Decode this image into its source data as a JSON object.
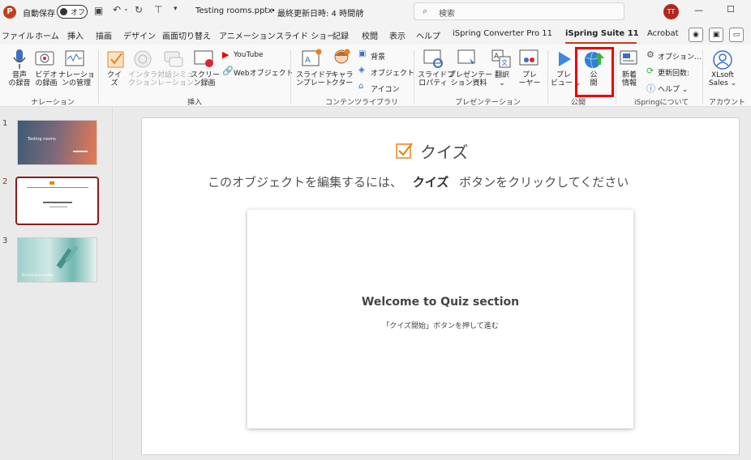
{
  "titlebar": {
    "app_icon": "P",
    "autosave_label": "自動保存",
    "autosave_state": "オフ",
    "filename": "Testing rooms.pptx",
    "separator": "•",
    "last_saved": "最終更新日時: 4 時間前",
    "search_placeholder": "検索",
    "user_initials": "TT"
  },
  "menu": {
    "tabs": [
      "ファイル",
      "ホーム",
      "挿入",
      "描画",
      "デザイン",
      "画面切り替え",
      "アニメーション",
      "スライド ショー",
      "記録",
      "校閲",
      "表示",
      "ヘルプ",
      "iSpring Converter Pro 11",
      "iSpring Suite 11",
      "Acrobat"
    ],
    "active_tab": "iSpring Suite 11"
  },
  "ribbon": {
    "narration": {
      "group": "ナレーション",
      "record_audio": [
        "音声",
        "の録音"
      ],
      "record_video": [
        "ビデオ",
        "の録画"
      ],
      "manage_narration": [
        "ナレーショ",
        "ンの管理"
      ]
    },
    "insert": {
      "group": "挿入",
      "quiz": [
        "クイ",
        "ズ"
      ],
      "interaction": [
        "インタラ",
        "クション"
      ],
      "dialog": [
        "対話シミュ",
        "レーション"
      ],
      "screen_record": [
        "スクリー",
        "ン録画"
      ],
      "youtube": "YouTube",
      "web_object": "Webオブジェクト"
    },
    "content_library": {
      "group": "コンテンツライブラリ",
      "slide_template": [
        "スライドテ",
        "ンプレート"
      ],
      "character": [
        "キャラ",
        "クター"
      ],
      "background": "背景",
      "objects": "オブジェクト",
      "icons": "アイコン"
    },
    "presentation": {
      "group": "プレゼンテーション",
      "slide_properties": [
        "スライドプ",
        "ロパティ"
      ],
      "presentation_resources": [
        "プレゼンテー",
        "ション資料"
      ],
      "translate": [
        "翻訳",
        "⌄"
      ],
      "player": [
        "プレ",
        "ーヤー"
      ]
    },
    "publish": {
      "group": "公開",
      "preview": [
        "プレ",
        "ビュー ⌄"
      ],
      "publish": [
        "公",
        "開"
      ]
    },
    "about": {
      "group": "iSpringについて",
      "whats_new": [
        "新着",
        "情報"
      ],
      "options": "オプション…",
      "update_count": "更新回数:",
      "help": "ヘルプ ⌄"
    },
    "account": {
      "group": "アカウント",
      "user": [
        "XLsoft",
        "Sales ⌄"
      ]
    }
  },
  "slides": {
    "numbers": [
      "1",
      "2",
      "3"
    ],
    "thumb1_title": "Testing rooms",
    "thumb3_text": "Ending Quiz section"
  },
  "slide": {
    "quiz_title": "クイズ",
    "instruction_before": "このオブジェクトを編集するには、",
    "instruction_bold": "クイズ",
    "instruction_after": "ボタンをクリックしてください",
    "card_title": "Welcome to Quiz section",
    "card_sub": "「クイズ開始」ボタンを押して進む"
  },
  "colors": {
    "accent": "#c43e1c",
    "highlight": "#ee0000",
    "quiz_icon": "#e8861c",
    "ispring_blue": "#2f7fd6"
  }
}
